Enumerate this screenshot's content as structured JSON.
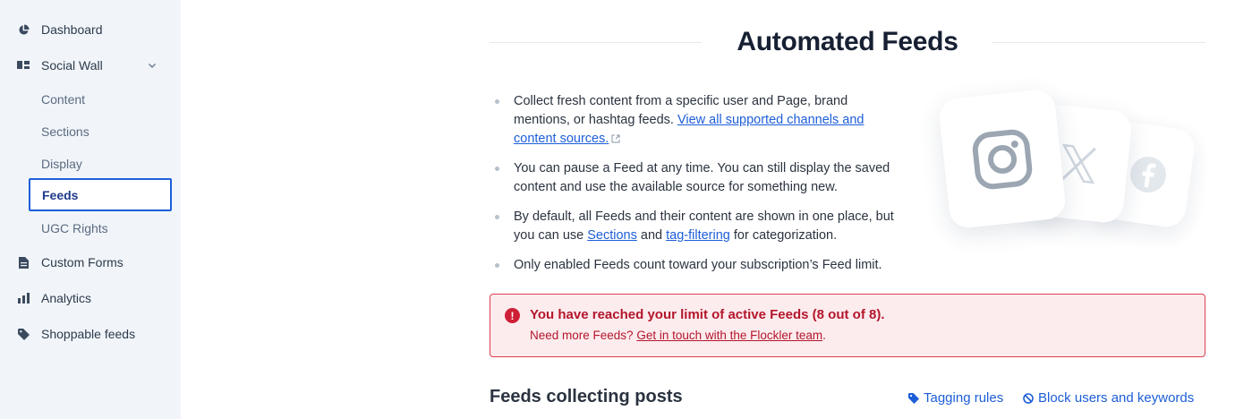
{
  "sidebar": {
    "items": [
      {
        "label": "Dashboard",
        "icon": "pie-chart-icon"
      },
      {
        "label": "Social Wall",
        "icon": "layout-icon"
      },
      {
        "label": "Custom Forms",
        "icon": "document-icon"
      },
      {
        "label": "Analytics",
        "icon": "bar-chart-icon"
      },
      {
        "label": "Shoppable feeds",
        "icon": "tag-icon"
      }
    ],
    "sub_items": [
      {
        "label": "Content"
      },
      {
        "label": "Sections"
      },
      {
        "label": "Display"
      },
      {
        "label": "Feeds",
        "active": true
      },
      {
        "label": "UGC Rights"
      }
    ]
  },
  "main": {
    "title": "Automated Feeds",
    "bullets": {
      "b1_text": "Collect fresh content from a specific user and Page, brand mentions, or hashtag feeds. ",
      "b1_link": "View all supported channels and content sources.",
      "b2_text": "You can pause a Feed at any time. You can still display the saved content and use the available source for something new.",
      "b3_text_a": "By default, all Feeds and their content are shown in one place, but you can use ",
      "b3_link_a": "Sections",
      "b3_text_b": " and ",
      "b3_link_b": "tag-filtering",
      "b3_text_c": " for categorization.",
      "b4_text": "Only enabled Feeds count toward your subscription’s Feed limit."
    },
    "alert": {
      "title": "You have reached your limit of active Feeds (8 out of 8).",
      "text": "Need more Feeds? ",
      "link": "Get in touch with the Flockler team",
      "suffix": "."
    },
    "section_title": "Feeds collecting posts",
    "actions": {
      "tagging_rules": "Tagging rules",
      "block_users": "Block users and keywords"
    }
  },
  "colors": {
    "accent": "#1d5ed8",
    "sidebar_bg": "#f1f5fa",
    "alert_bg": "#fdecee",
    "alert_text": "#b3162c"
  }
}
